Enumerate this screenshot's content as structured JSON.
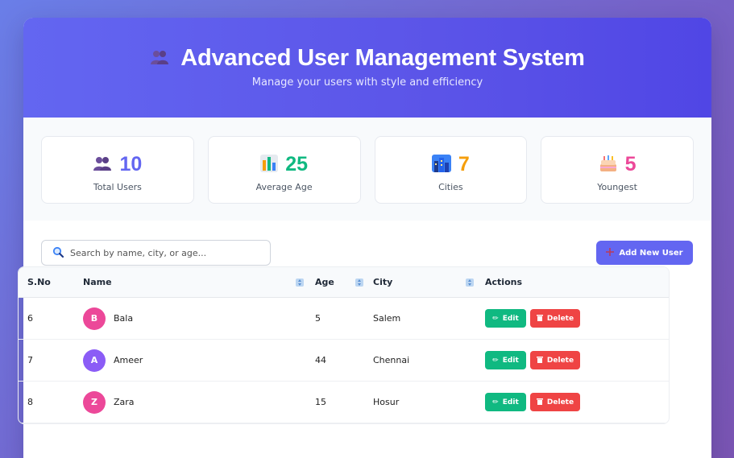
{
  "header": {
    "icon": "users-icon",
    "title": "Advanced User Management System",
    "subtitle": "Manage your users with style and efficiency"
  },
  "stats": [
    {
      "icon": "users-icon",
      "value": "10",
      "label": "Total Users",
      "color": "#6366f1"
    },
    {
      "icon": "bar-chart-icon",
      "value": "25",
      "label": "Average Age",
      "color": "#10b981"
    },
    {
      "icon": "city-icon",
      "value": "7",
      "label": "Cities",
      "color": "#f59e0b"
    },
    {
      "icon": "cake-icon",
      "value": "5",
      "label": "Youngest",
      "color": "#ec4899"
    }
  ],
  "toolbar": {
    "search_placeholder": "Search by name, city, or age...",
    "add_label": "Add New User"
  },
  "table": {
    "headers": {
      "sno": "S.No",
      "name": "Name",
      "age": "Age",
      "city": "City",
      "actions": "Actions"
    },
    "edit_label": "Edit",
    "delete_label": "Delete",
    "rows": [
      {
        "sno": "6",
        "initial": "B",
        "name": "Bala",
        "age": "5",
        "city": "Salem",
        "avatar_color": "#ec4899"
      },
      {
        "sno": "7",
        "initial": "A",
        "name": "Ameer",
        "age": "44",
        "city": "Chennai",
        "avatar_color": "#8b5cf6"
      },
      {
        "sno": "8",
        "initial": "Z",
        "name": "Zara",
        "age": "15",
        "city": "Hosur",
        "avatar_color": "#ec4899"
      }
    ]
  },
  "colors": {
    "accent": "#6366f1",
    "edit": "#10b981",
    "delete": "#ef4444"
  }
}
